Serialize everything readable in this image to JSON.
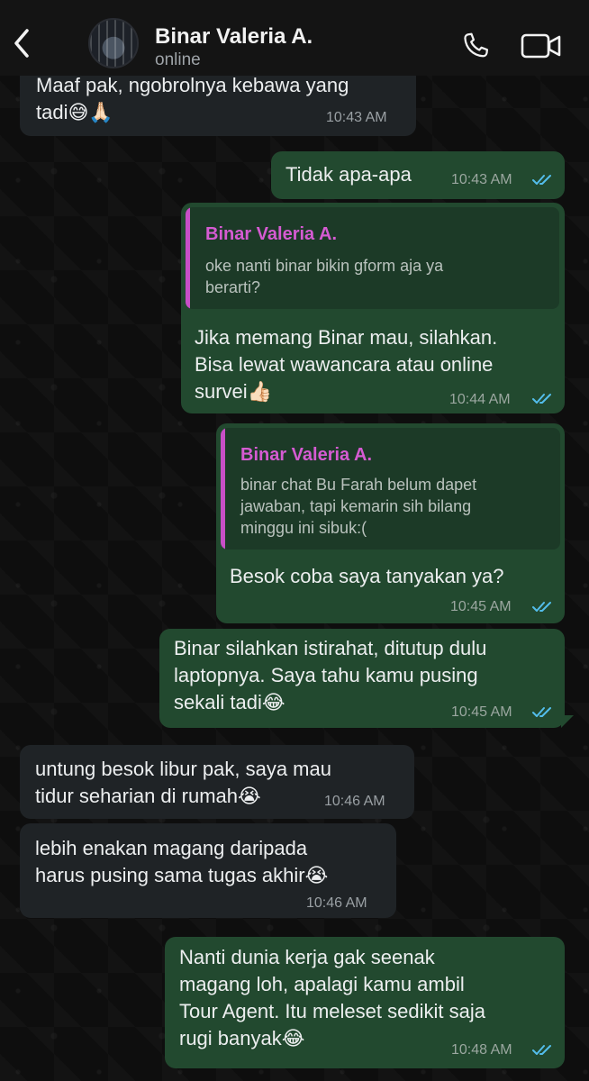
{
  "header": {
    "contact_name": "Binar Valeria A.",
    "status": "online",
    "icons": [
      "back-chevron-icon",
      "phone-icon",
      "video-camera-icon"
    ]
  },
  "messages": [
    {
      "direction": "incoming",
      "text": "Maaf pak, ngobrolnya kebawa yang\ntadi😅🙏🏻",
      "time": "10:43 AM"
    },
    {
      "direction": "outgoing",
      "text": "Tidak apa-apa",
      "time": "10:43 AM",
      "read": true
    },
    {
      "direction": "outgoing",
      "quote_name": "Binar Valeria A.",
      "quote_text": "oke nanti binar bikin gform aja ya\nberarti?",
      "text": "Jika memang Binar mau, silahkan.\nBisa lewat wawancara atau online\nsurvei👍🏻",
      "time": "10:44 AM",
      "read": true
    },
    {
      "direction": "outgoing",
      "quote_name": "Binar Valeria A.",
      "quote_text": "binar chat Bu Farah belum dapet\njawaban, tapi kemarin sih bilang\nminggu ini sibuk:(",
      "text": "Besok coba saya tanyakan ya?",
      "time": "10:45 AM",
      "read": true
    },
    {
      "direction": "outgoing",
      "text": "Binar silahkan istirahat, ditutup dulu\nlaptopnya. Saya tahu kamu pusing\nsekali tadi😂",
      "time": "10:45 AM",
      "read": true
    },
    {
      "direction": "incoming",
      "text": "untung besok libur pak, saya mau\ntidur seharian di rumah😭",
      "time": "10:46 AM"
    },
    {
      "direction": "incoming",
      "text": "lebih enakan magang daripada\nharus pusing sama tugas akhir😭",
      "time": "10:46 AM"
    },
    {
      "direction": "outgoing",
      "text": "Nanti dunia kerja gak seenak\nmagang loh, apalagi kamu ambil\nTour Agent. Itu meleset sedikit saja\nrugi banyak😂",
      "time": "10:48 AM",
      "read": true
    }
  ],
  "colors": {
    "incoming_bubble": "#1f2326",
    "outgoing_bubble": "#22492f",
    "read_ticks": "#53bdeb",
    "quote_accent": "#d55bd2"
  }
}
